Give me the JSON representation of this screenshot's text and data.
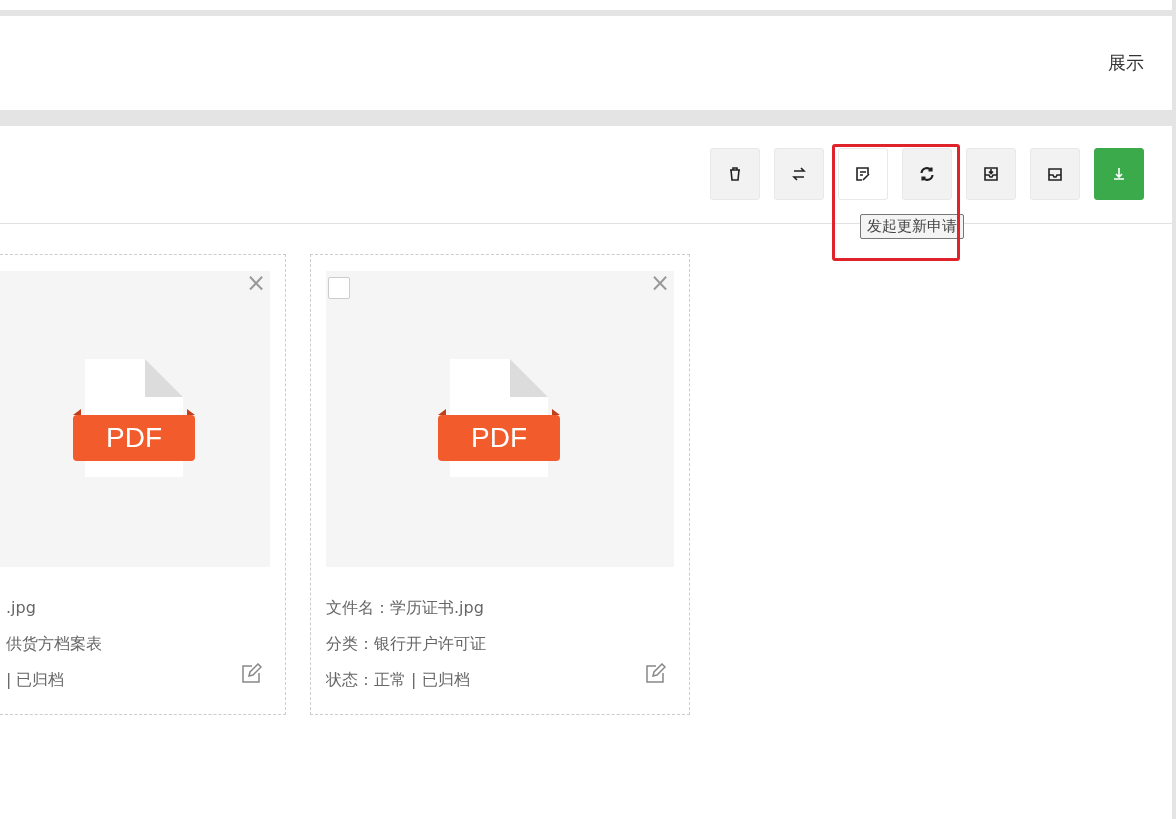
{
  "header": {
    "link": "展示"
  },
  "toolbar": {
    "buttons": [
      {
        "kind": "delete",
        "hovered": false,
        "primary": false
      },
      {
        "kind": "swap",
        "hovered": false,
        "primary": false
      },
      {
        "kind": "note",
        "hovered": true,
        "primary": false
      },
      {
        "kind": "refresh",
        "hovered": false,
        "primary": false
      },
      {
        "kind": "inbox-in",
        "hovered": false,
        "primary": false
      },
      {
        "kind": "inbox",
        "hovered": false,
        "primary": false
      },
      {
        "kind": "download",
        "hovered": false,
        "primary": true
      }
    ],
    "tooltip": "发起更新申请",
    "annotation_frame": true
  },
  "cards": [
    {
      "partial": true,
      "checkbox": false,
      "close": "×",
      "badge": "PDF",
      "lines": [
        ".jpg",
        "供货方档案表",
        "| 已归档"
      ]
    },
    {
      "partial": false,
      "checkbox": true,
      "checked": false,
      "close": "×",
      "badge": "PDF",
      "lines": [
        "文件名：学历证书.jpg",
        "分类：银行开户许可证",
        "状态：正常 | 已归档"
      ]
    }
  ]
}
